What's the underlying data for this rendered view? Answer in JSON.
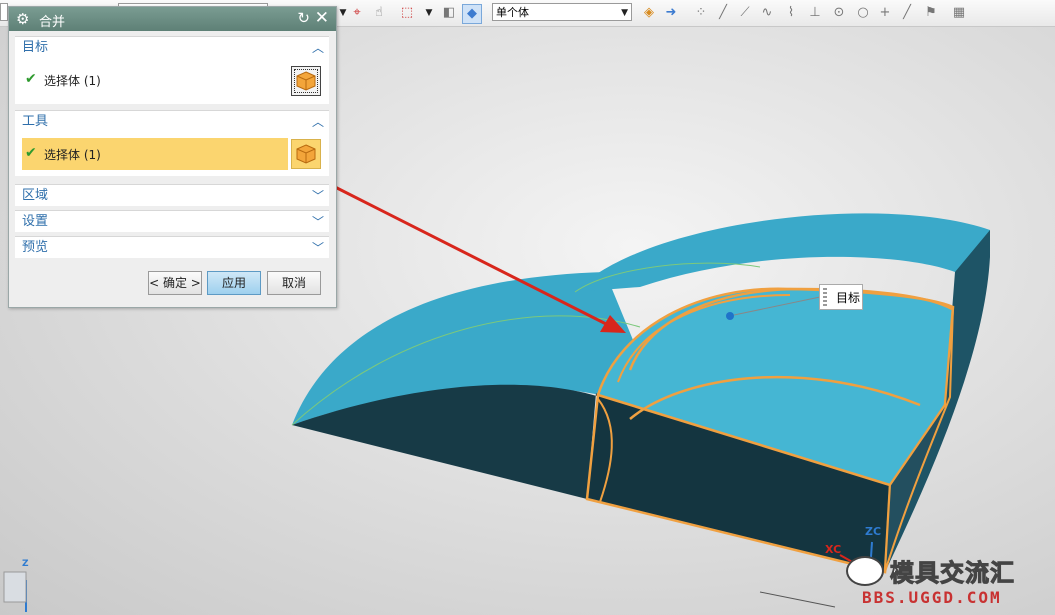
{
  "toolbar": {
    "selection_filter": "单个体"
  },
  "dialog": {
    "title": "合并",
    "sections": {
      "target": {
        "label": "目标",
        "row_label": "选择体 (1)"
      },
      "tool": {
        "label": "工具",
        "row_label": "选择体 (1)"
      },
      "region": {
        "label": "区域"
      },
      "settings": {
        "label": "设置"
      },
      "preview": {
        "label": "预览"
      }
    },
    "buttons": {
      "ok": "< 确定 >",
      "apply": "应用",
      "cancel": "取消"
    }
  },
  "viewport": {
    "callout_label": "目标",
    "axis_labels": {
      "zc": "ZC",
      "xc": "XC",
      "z": "Z"
    }
  },
  "watermark": {
    "text": "模具交流汇",
    "url": "BBS.UGGD.COM"
  },
  "colors": {
    "accent": "#2f6fab",
    "active_row": "#fbd56f",
    "titlebar": "#5e8076",
    "model_top": "#3aa9c9",
    "model_side": "#173a46",
    "edge_highlight": "#f0a040",
    "arrow": "#d8261c"
  }
}
